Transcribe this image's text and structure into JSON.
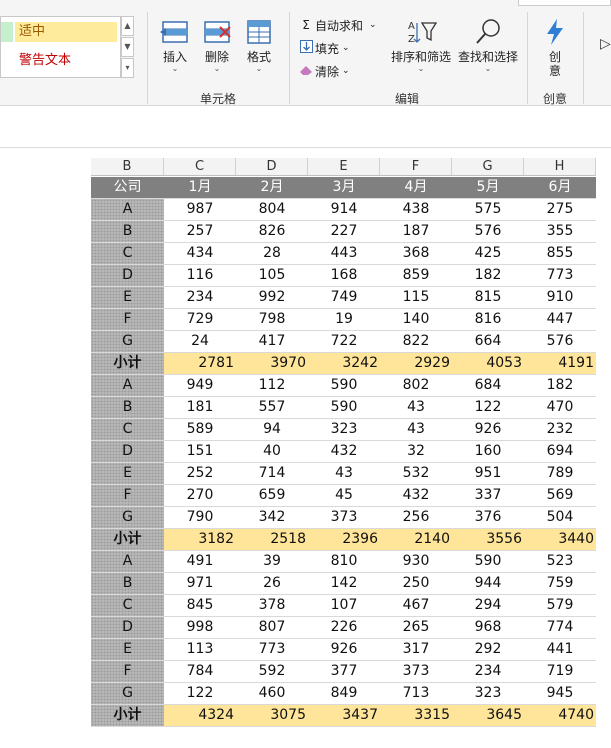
{
  "styles": {
    "neutral": "适中",
    "warning": "警告文本"
  },
  "ribbon": {
    "insert": "插入",
    "delete": "删除",
    "format": "格式",
    "cells_group": "单元格",
    "autosum": "自动求和",
    "fill": "填充",
    "clear": "清除",
    "sort_filter": "排序和筛选",
    "find_select": "查找和选择",
    "editing_group": "编辑",
    "ideas_l1": "创",
    "ideas_l2": "意",
    "ideas_group": "创意"
  },
  "colors": {
    "header": "#808080",
    "subtotal": "#ffe599",
    "neutral_fill": "#ffeb9c",
    "warning_text": "#c00000"
  },
  "columns": [
    "B",
    "C",
    "D",
    "E",
    "F",
    "G",
    "H"
  ],
  "header_row": [
    "公司",
    "1月",
    "2月",
    "3月",
    "4月",
    "5月",
    "6月"
  ],
  "rows": [
    {
      "label": "A",
      "values": [
        "987",
        "804",
        "914",
        "438",
        "575",
        "275"
      ]
    },
    {
      "label": "B",
      "values": [
        "257",
        "826",
        "227",
        "187",
        "576",
        "355"
      ]
    },
    {
      "label": "C",
      "values": [
        "434",
        "28",
        "443",
        "368",
        "425",
        "855"
      ]
    },
    {
      "label": "D",
      "values": [
        "116",
        "105",
        "168",
        "859",
        "182",
        "773"
      ]
    },
    {
      "label": "E",
      "values": [
        "234",
        "992",
        "749",
        "115",
        "815",
        "910"
      ]
    },
    {
      "label": "F",
      "values": [
        "729",
        "798",
        "19",
        "140",
        "816",
        "447"
      ]
    },
    {
      "label": "G",
      "values": [
        "24",
        "417",
        "722",
        "822",
        "664",
        "576"
      ]
    },
    {
      "label": "小计",
      "subtotal": true,
      "values": [
        "2781",
        "3970",
        "3242",
        "2929",
        "4053",
        "4191"
      ]
    },
    {
      "label": "A",
      "values": [
        "949",
        "112",
        "590",
        "802",
        "684",
        "182"
      ]
    },
    {
      "label": "B",
      "values": [
        "181",
        "557",
        "590",
        "43",
        "122",
        "470"
      ]
    },
    {
      "label": "C",
      "values": [
        "589",
        "94",
        "323",
        "43",
        "926",
        "232"
      ]
    },
    {
      "label": "D",
      "values": [
        "151",
        "40",
        "432",
        "32",
        "160",
        "694"
      ]
    },
    {
      "label": "E",
      "values": [
        "252",
        "714",
        "43",
        "532",
        "951",
        "789"
      ]
    },
    {
      "label": "F",
      "values": [
        "270",
        "659",
        "45",
        "432",
        "337",
        "569"
      ]
    },
    {
      "label": "G",
      "values": [
        "790",
        "342",
        "373",
        "256",
        "376",
        "504"
      ]
    },
    {
      "label": "小计",
      "subtotal": true,
      "values": [
        "3182",
        "2518",
        "2396",
        "2140",
        "3556",
        "3440"
      ]
    },
    {
      "label": "A",
      "values": [
        "491",
        "39",
        "810",
        "930",
        "590",
        "523"
      ]
    },
    {
      "label": "B",
      "values": [
        "971",
        "26",
        "142",
        "250",
        "944",
        "759"
      ]
    },
    {
      "label": "C",
      "values": [
        "845",
        "378",
        "107",
        "467",
        "294",
        "579"
      ]
    },
    {
      "label": "D",
      "values": [
        "998",
        "807",
        "226",
        "265",
        "968",
        "774"
      ]
    },
    {
      "label": "E",
      "values": [
        "113",
        "773",
        "926",
        "317",
        "292",
        "441"
      ]
    },
    {
      "label": "F",
      "values": [
        "784",
        "592",
        "377",
        "373",
        "234",
        "719"
      ]
    },
    {
      "label": "G",
      "values": [
        "122",
        "460",
        "849",
        "713",
        "323",
        "945"
      ]
    },
    {
      "label": "小计",
      "subtotal": true,
      "values": [
        "4324",
        "3075",
        "3437",
        "3315",
        "3645",
        "4740"
      ]
    }
  ]
}
